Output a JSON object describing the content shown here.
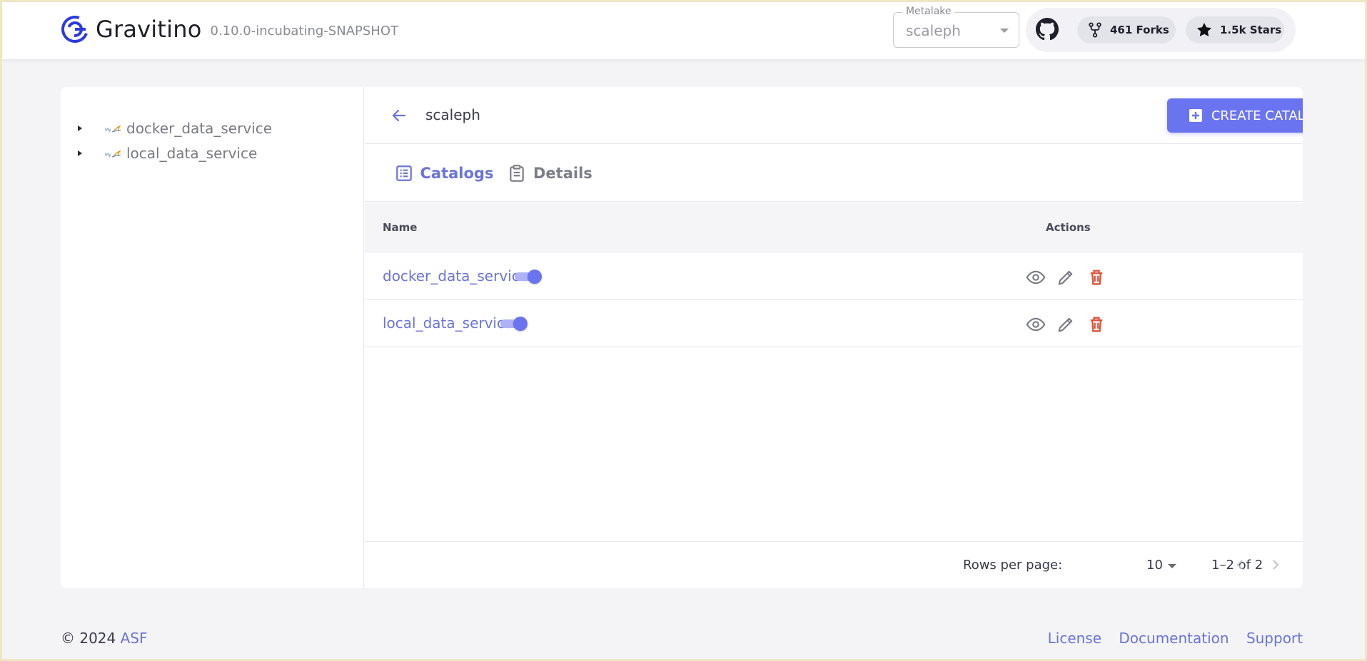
{
  "header": {
    "app_name": "Gravitino",
    "version": "0.10.0-incubating-SNAPSHOT",
    "metalake_label": "Metalake",
    "metalake_value": "scaleph",
    "forks_label": "461 Forks",
    "stars_label": "1.5k Stars"
  },
  "tree": {
    "items": [
      {
        "label": "docker_data_service",
        "icon": "mysql-db-icon"
      },
      {
        "label": "local_data_service",
        "icon": "mysql-db-icon"
      }
    ]
  },
  "panel": {
    "breadcrumb": "scaleph",
    "create_button": "CREATE CATALOG",
    "tabs": [
      {
        "label": "Catalogs",
        "active": true
      },
      {
        "label": "Details",
        "active": false
      }
    ],
    "table": {
      "columns": [
        "Name",
        "Actions"
      ],
      "rows": [
        {
          "name": "docker_data_service",
          "enabled": true
        },
        {
          "name": "local_data_service",
          "enabled": true
        }
      ]
    },
    "pagination": {
      "rows_per_page_label": "Rows per page:",
      "rows_per_page_value": "10",
      "range": "1–2 of 2"
    }
  },
  "footer": {
    "copyright": "© 2024",
    "org": "ASF",
    "links": [
      "License",
      "Documentation",
      "Support"
    ]
  },
  "colors": {
    "accent": "#6b74f0",
    "link": "#6b74d8",
    "danger": "#e0533a"
  }
}
